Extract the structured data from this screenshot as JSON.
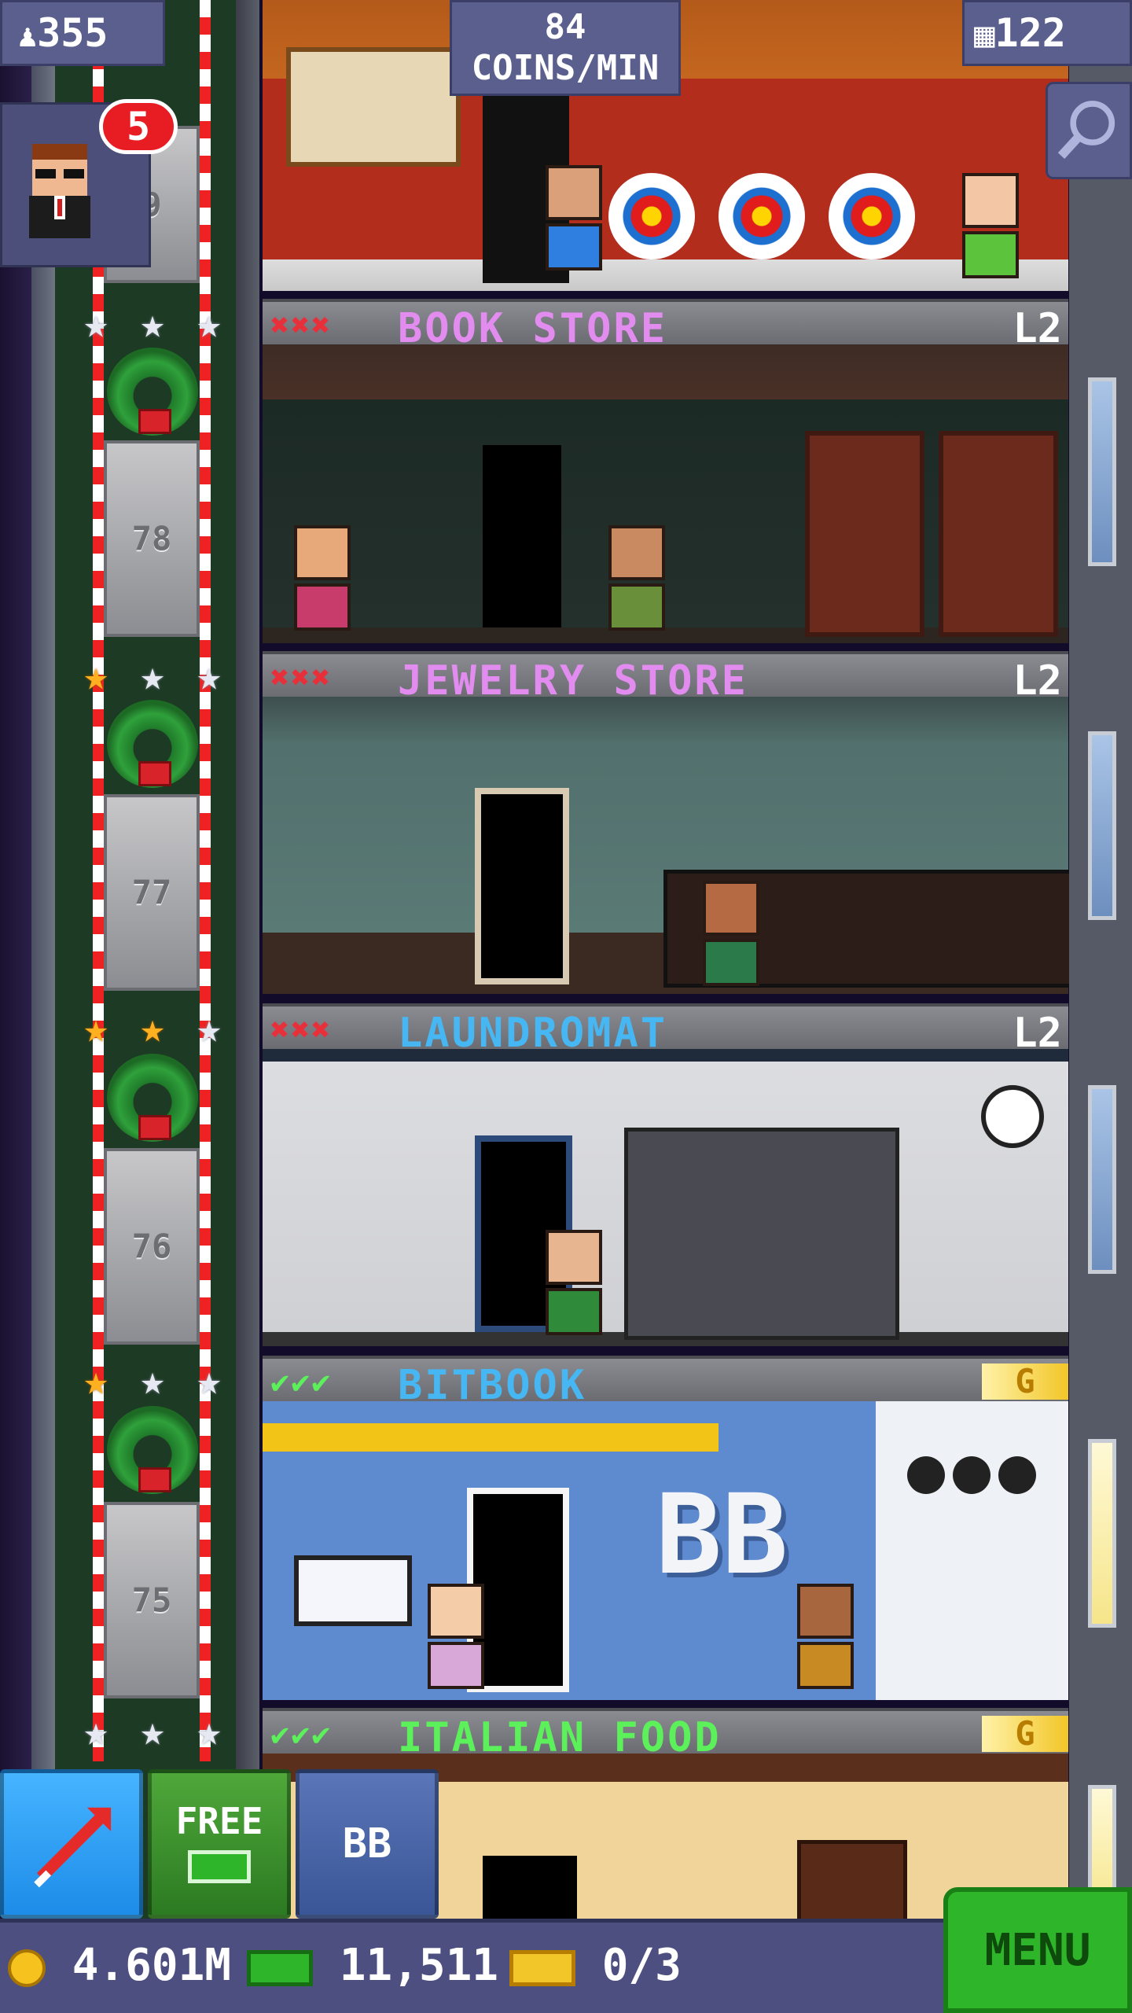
{
  "hud": {
    "population": "355",
    "coins_rate_value": "84",
    "coins_rate_unit": "COINS/MIN",
    "floors_count": "122",
    "vip_count": "5"
  },
  "elevator": {
    "floor_numbers": [
      "9",
      "78",
      "77",
      "76",
      "75"
    ],
    "star_rows": [
      [
        "silver",
        "silver",
        "silver"
      ],
      [
        "gold",
        "silver",
        "silver"
      ],
      [
        "gold",
        "gold",
        "silver"
      ],
      [
        "gold",
        "silver",
        "silver"
      ],
      [
        "silver",
        "silver",
        "silver"
      ]
    ]
  },
  "floors": [
    {
      "name": "BOOK STORE",
      "status": "✖✖✖",
      "status_color": "#e8303a",
      "name_color": "#e38cf0",
      "level": "L2"
    },
    {
      "name": "JEWELRY STORE",
      "status": "✖✖✖",
      "status_color": "#e8303a",
      "name_color": "#e38cf0",
      "level": "L2"
    },
    {
      "name": "LAUNDROMAT",
      "status": "✖✖✖",
      "status_color": "#e8303a",
      "name_color": "#46b7f2",
      "level": "L2"
    },
    {
      "name": "BITBOOK",
      "status": "✔✔✔",
      "status_color": "#5cf05a",
      "name_color": "#46b7f2",
      "level": "G"
    },
    {
      "name": "ITALIAN FOOD",
      "status": "✔✔✔",
      "status_color": "#5cf05a",
      "name_color": "#5cf05a",
      "level": "G"
    }
  ],
  "bitbook_sign": "BB",
  "buttons": {
    "free_label": "FREE",
    "bb_label": "BB",
    "menu_label": "MENU"
  },
  "resources": {
    "coins": "4.601M",
    "bux": "11,511",
    "tickets": "0/3"
  }
}
